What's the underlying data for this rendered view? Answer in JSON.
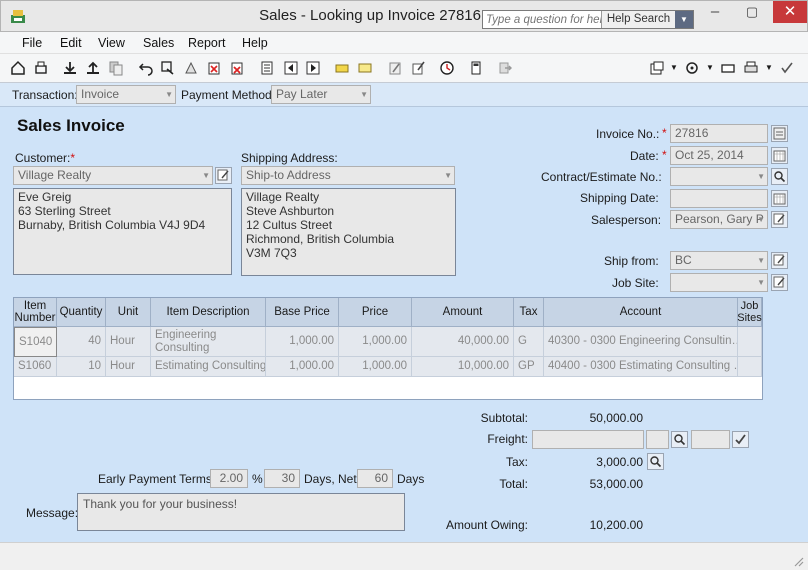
{
  "window": {
    "title": "Sales - Looking up Invoice 27816",
    "minimize": "–",
    "restore": "▢",
    "close": "✕"
  },
  "help": {
    "placeholder": "Type a question for help",
    "search_label": "Help Search"
  },
  "menu": [
    "File",
    "Edit",
    "View",
    "Sales",
    "Report",
    "Help"
  ],
  "toolbar_icons": [
    "home-icon",
    "print-preview-icon",
    "save-icon",
    "upload-icon",
    "copy-icon",
    "undo-icon",
    "recall-icon",
    "track-icon",
    "remove-icon",
    "delete-icon",
    "journal-icon",
    "previous-icon",
    "next-icon",
    "notes-icon",
    "email-icon",
    "pencil-icon",
    "edit-icon",
    "time-icon",
    "calculator-icon",
    "export-icon"
  ],
  "transaction": {
    "label": "Transaction:",
    "value": "Invoice",
    "payment_label": "Payment Method:",
    "payment_value": "Pay Later"
  },
  "header": {
    "title": "Sales Invoice"
  },
  "customer": {
    "label": "Customer:",
    "value": "Village Realty",
    "address": [
      "Eve Greig",
      "63 Sterling Street",
      "Burnaby, British Columbia V4J 9D4"
    ]
  },
  "shipping": {
    "label": "Shipping Address:",
    "value": "Ship-to Address",
    "address": [
      "Village Realty",
      "Steve Ashburton",
      "12 Cultus Street",
      "Richmond, British Columbia",
      "V3M 7Q3"
    ]
  },
  "invoice": {
    "no_label": "Invoice No.:",
    "no_value": "27816",
    "date_label": "Date:",
    "date_value": "Oct 25, 2014",
    "contract_label": "Contract/Estimate No.:",
    "contract_value": "",
    "ship_date_label": "Shipping Date:",
    "ship_date_value": "",
    "salesperson_label": "Salesperson:",
    "salesperson_value": "Pearson, Gary P",
    "ship_from_label": "Ship from:",
    "ship_from_value": "BC",
    "job_site_label": "Job Site:",
    "job_site_value": ""
  },
  "table": {
    "headers": [
      "Item Number",
      "Quantity",
      "Unit",
      "Item Description",
      "Base Price",
      "Price",
      "Amount",
      "Tax",
      "Account",
      "Job Sites"
    ],
    "rows": [
      {
        "item": "S1040",
        "qty": "40",
        "unit": "Hour",
        "desc": "Engineering Consulting",
        "base": "1,000.00",
        "price": "1,000.00",
        "amount": "40,000.00",
        "tax": "G",
        "account": "40300 - 0300 Engineering Consultin…"
      },
      {
        "item": "S1060",
        "qty": "10",
        "unit": "Hour",
        "desc": "Estimating Consulting",
        "base": "1,000.00",
        "price": "1,000.00",
        "amount": "10,000.00",
        "tax": "GP",
        "account": "40400 - 0300 Estimating Consulting …"
      }
    ]
  },
  "totals": {
    "subtotal_label": "Subtotal:",
    "subtotal": "50,000.00",
    "freight_label": "Freight:",
    "tax_label": "Tax:",
    "tax": "3,000.00",
    "total_label": "Total:",
    "total": "53,000.00",
    "owing_label": "Amount Owing:",
    "owing": "10,200.00"
  },
  "terms": {
    "label": "Early Payment Terms:",
    "pct": "2.00",
    "pct_sign": "%",
    "days": "30",
    "days_label": "Days, Net",
    "net": "60",
    "net_label": "Days"
  },
  "message": {
    "label": "Message:",
    "value": "Thank you for your business!"
  },
  "colors": {
    "form_bg": "#cfe3f8",
    "close_red": "#c7383a",
    "required": "#d01010"
  }
}
